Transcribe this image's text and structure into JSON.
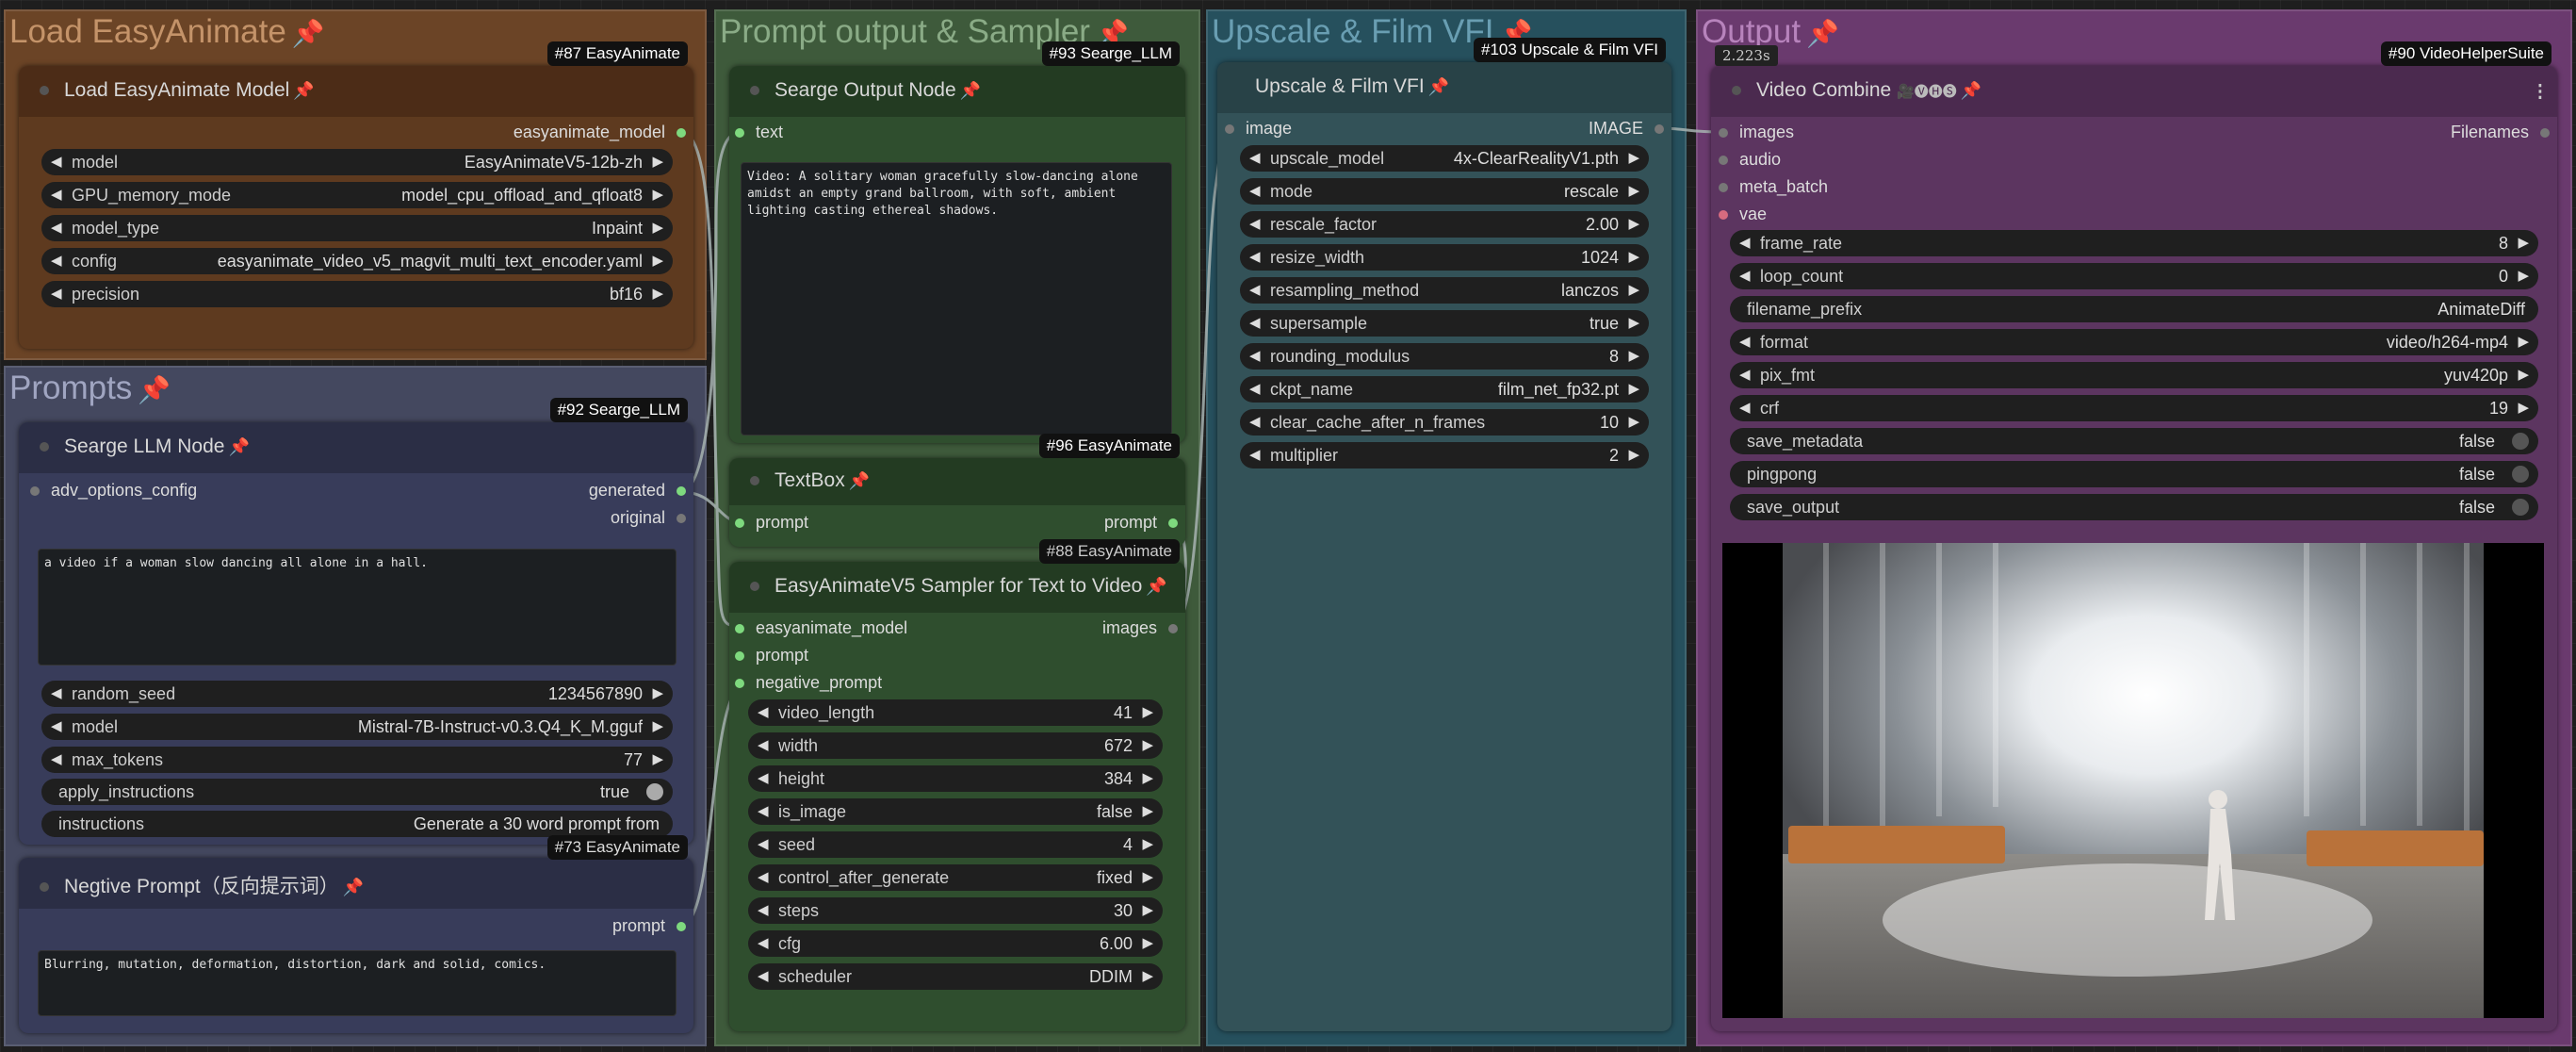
{
  "groups": {
    "load": "Load EasyAnimate",
    "prompts": "Prompts",
    "prompt_sampler": "Prompt output & Sampler",
    "upscale": "Upscale & Film VFI",
    "output": "Output"
  },
  "load_model_node": {
    "title": "Load EasyAnimate Model",
    "badge": "#87 EasyAnimate",
    "output": "easyanimate_model",
    "widgets": [
      {
        "label": "model",
        "value": "EasyAnimateV5-12b-zh"
      },
      {
        "label": "GPU_memory_mode",
        "value": "model_cpu_offload_and_qfloat8"
      },
      {
        "label": "model_type",
        "value": "Inpaint"
      },
      {
        "label": "config",
        "value": "easyanimate_video_v5_magvit_multi_text_encoder.yaml"
      },
      {
        "label": "precision",
        "value": "bf16"
      }
    ]
  },
  "llm_node": {
    "title": "Searge LLM Node",
    "badge": "#92 Searge_LLM",
    "input": "adv_options_config",
    "out_generated": "generated",
    "out_original": "original",
    "text": "a video if a woman slow dancing all alone in a hall.",
    "widgets": [
      {
        "label": "random_seed",
        "value": "1234567890"
      },
      {
        "label": "model",
        "value": "Mistral-7B-Instruct-v0.3.Q4_K_M.gguf"
      },
      {
        "label": "max_tokens",
        "value": "77"
      }
    ],
    "apply_instructions": {
      "label": "apply_instructions",
      "value": "true"
    },
    "instructions": {
      "label": "instructions",
      "value": "Generate a 30 word prompt from"
    }
  },
  "neg_node": {
    "title": "Negtive Prompt（反向提示词）",
    "badge": "#73 EasyAnimate",
    "output": "prompt",
    "text": "Blurring, mutation, deformation, distortion, dark and solid, comics."
  },
  "searge_output_node": {
    "title": "Searge Output Node",
    "badge": "#93 Searge_LLM",
    "input": "text",
    "text": "Video: A solitary woman gracefully slow-dancing alone\namidst an empty grand ballroom, with soft, ambient\nlighting casting ethereal shadows."
  },
  "textbox_node": {
    "title": "TextBox",
    "badge": "#96 EasyAnimate",
    "input": "prompt",
    "output": "prompt"
  },
  "sampler_node": {
    "title": "EasyAnimateV5 Sampler for Text to Video",
    "badge": "#88 EasyAnimate",
    "inputs": [
      "easyanimate_model",
      "prompt",
      "negative_prompt"
    ],
    "output": "images",
    "widgets": [
      {
        "label": "video_length",
        "value": "41"
      },
      {
        "label": "width",
        "value": "672"
      },
      {
        "label": "height",
        "value": "384"
      },
      {
        "label": "is_image",
        "value": "false"
      },
      {
        "label": "seed",
        "value": "4"
      },
      {
        "label": "control_after_generate",
        "value": "fixed"
      },
      {
        "label": "steps",
        "value": "30"
      },
      {
        "label": "cfg",
        "value": "6.00"
      },
      {
        "label": "scheduler",
        "value": "DDIM"
      }
    ]
  },
  "upscale_node": {
    "title": "Upscale & Film VFI",
    "badge": "#103 Upscale & Film VFI",
    "input": "image",
    "output": "IMAGE",
    "widgets": [
      {
        "label": "upscale_model",
        "value": "4x-ClearRealityV1.pth"
      },
      {
        "label": "mode",
        "value": "rescale"
      },
      {
        "label": "rescale_factor",
        "value": "2.00"
      },
      {
        "label": "resize_width",
        "value": "1024"
      },
      {
        "label": "resampling_method",
        "value": "lanczos"
      },
      {
        "label": "supersample",
        "value": "true"
      },
      {
        "label": "rounding_modulus",
        "value": "8"
      },
      {
        "label": "ckpt_name",
        "value": "film_net_fp32.pt"
      },
      {
        "label": "clear_cache_after_n_frames",
        "value": "10"
      },
      {
        "label": "multiplier",
        "value": "2"
      }
    ]
  },
  "video_node": {
    "title": "Video Combine",
    "title_icons": "🎥🅥🅗🅢",
    "badge": "#90 VideoHelperSuite",
    "timing": "2.223s",
    "inputs": [
      "images",
      "audio",
      "meta_batch",
      "vae"
    ],
    "output": "Filenames",
    "widgets": [
      {
        "label": "frame_rate",
        "value": "8",
        "arrows": true
      },
      {
        "label": "loop_count",
        "value": "0",
        "arrows": true
      },
      {
        "label": "filename_prefix",
        "value": "AnimateDiff",
        "arrows": false
      },
      {
        "label": "format",
        "value": "video/h264-mp4",
        "arrows": true
      },
      {
        "label": "pix_fmt",
        "value": "yuv420p",
        "arrows": true
      },
      {
        "label": "crf",
        "value": "19",
        "arrows": true
      }
    ],
    "toggles": [
      {
        "label": "save_metadata",
        "value": "false"
      },
      {
        "label": "pingpong",
        "value": "false"
      },
      {
        "label": "save_output",
        "value": "false"
      }
    ]
  },
  "colors": {
    "load_group": "#7a4a2a",
    "prompts_group": "#4a4e6e",
    "sampler_group": "#3c5a3a",
    "upscale_group": "#284b5a",
    "output_group": "#6e3c72",
    "wire": "#9aa6a6",
    "pin": "#e8475a"
  }
}
